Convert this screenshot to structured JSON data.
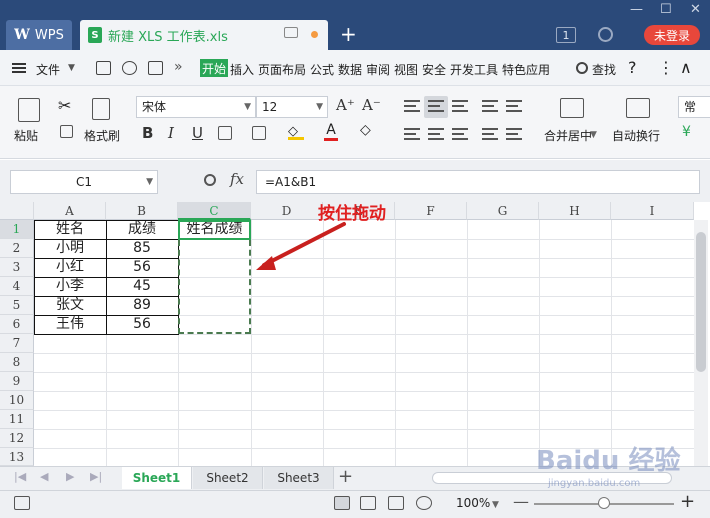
{
  "titlebar": {
    "wps_label": "WPS",
    "doc_title": "新建 XLS 工作表.xls",
    "new_tab": "+",
    "badge": "1",
    "login": "未登录"
  },
  "menu": {
    "file": "文件",
    "more": "»",
    "items": [
      "开始",
      "插入",
      "页面布局",
      "公式",
      "数据",
      "审阅",
      "视图",
      "安全",
      "开发工具",
      "特色应用"
    ],
    "search": "查找",
    "help": "?",
    "more_options": "⋮",
    "collapse": "∧"
  },
  "ribbon": {
    "paste": "粘贴",
    "format_painter": "格式刷",
    "font_name": "宋体",
    "font_size": "12",
    "bold": "B",
    "italic": "I",
    "underline": "U",
    "merge": "合并居中",
    "wrap": "自动换行",
    "normal": "常"
  },
  "formula_bar": {
    "name_box": "C1",
    "fx": "fx",
    "formula": "=A1&B1"
  },
  "columns": [
    "A",
    "B",
    "C",
    "D",
    "E",
    "F",
    "G",
    "H",
    "I"
  ],
  "rows": [
    "1",
    "2",
    "3",
    "4",
    "5",
    "6",
    "7",
    "8",
    "9",
    "10",
    "11",
    "12",
    "13"
  ],
  "cells": {
    "header": [
      "姓名",
      "成绩",
      "姓名成绩"
    ],
    "names": [
      "小明",
      "小红",
      "小李",
      "张文",
      "王伟"
    ],
    "scores": [
      "85",
      "56",
      "45",
      "89",
      "56"
    ]
  },
  "annotation": "按住拖动",
  "sheets": [
    "Sheet1",
    "Sheet2",
    "Sheet3"
  ],
  "add_sheet": "+",
  "status": {
    "zoom": "100%",
    "zoom_minus": "—",
    "zoom_plus": "+"
  },
  "watermark": {
    "main": "Baidu 经验",
    "sub": "jingyan.baidu.com"
  },
  "colors": {
    "accent": "#2aa757",
    "titlebar": "#2b4a7a",
    "login": "#e8473b",
    "annotation": "#e02020"
  }
}
